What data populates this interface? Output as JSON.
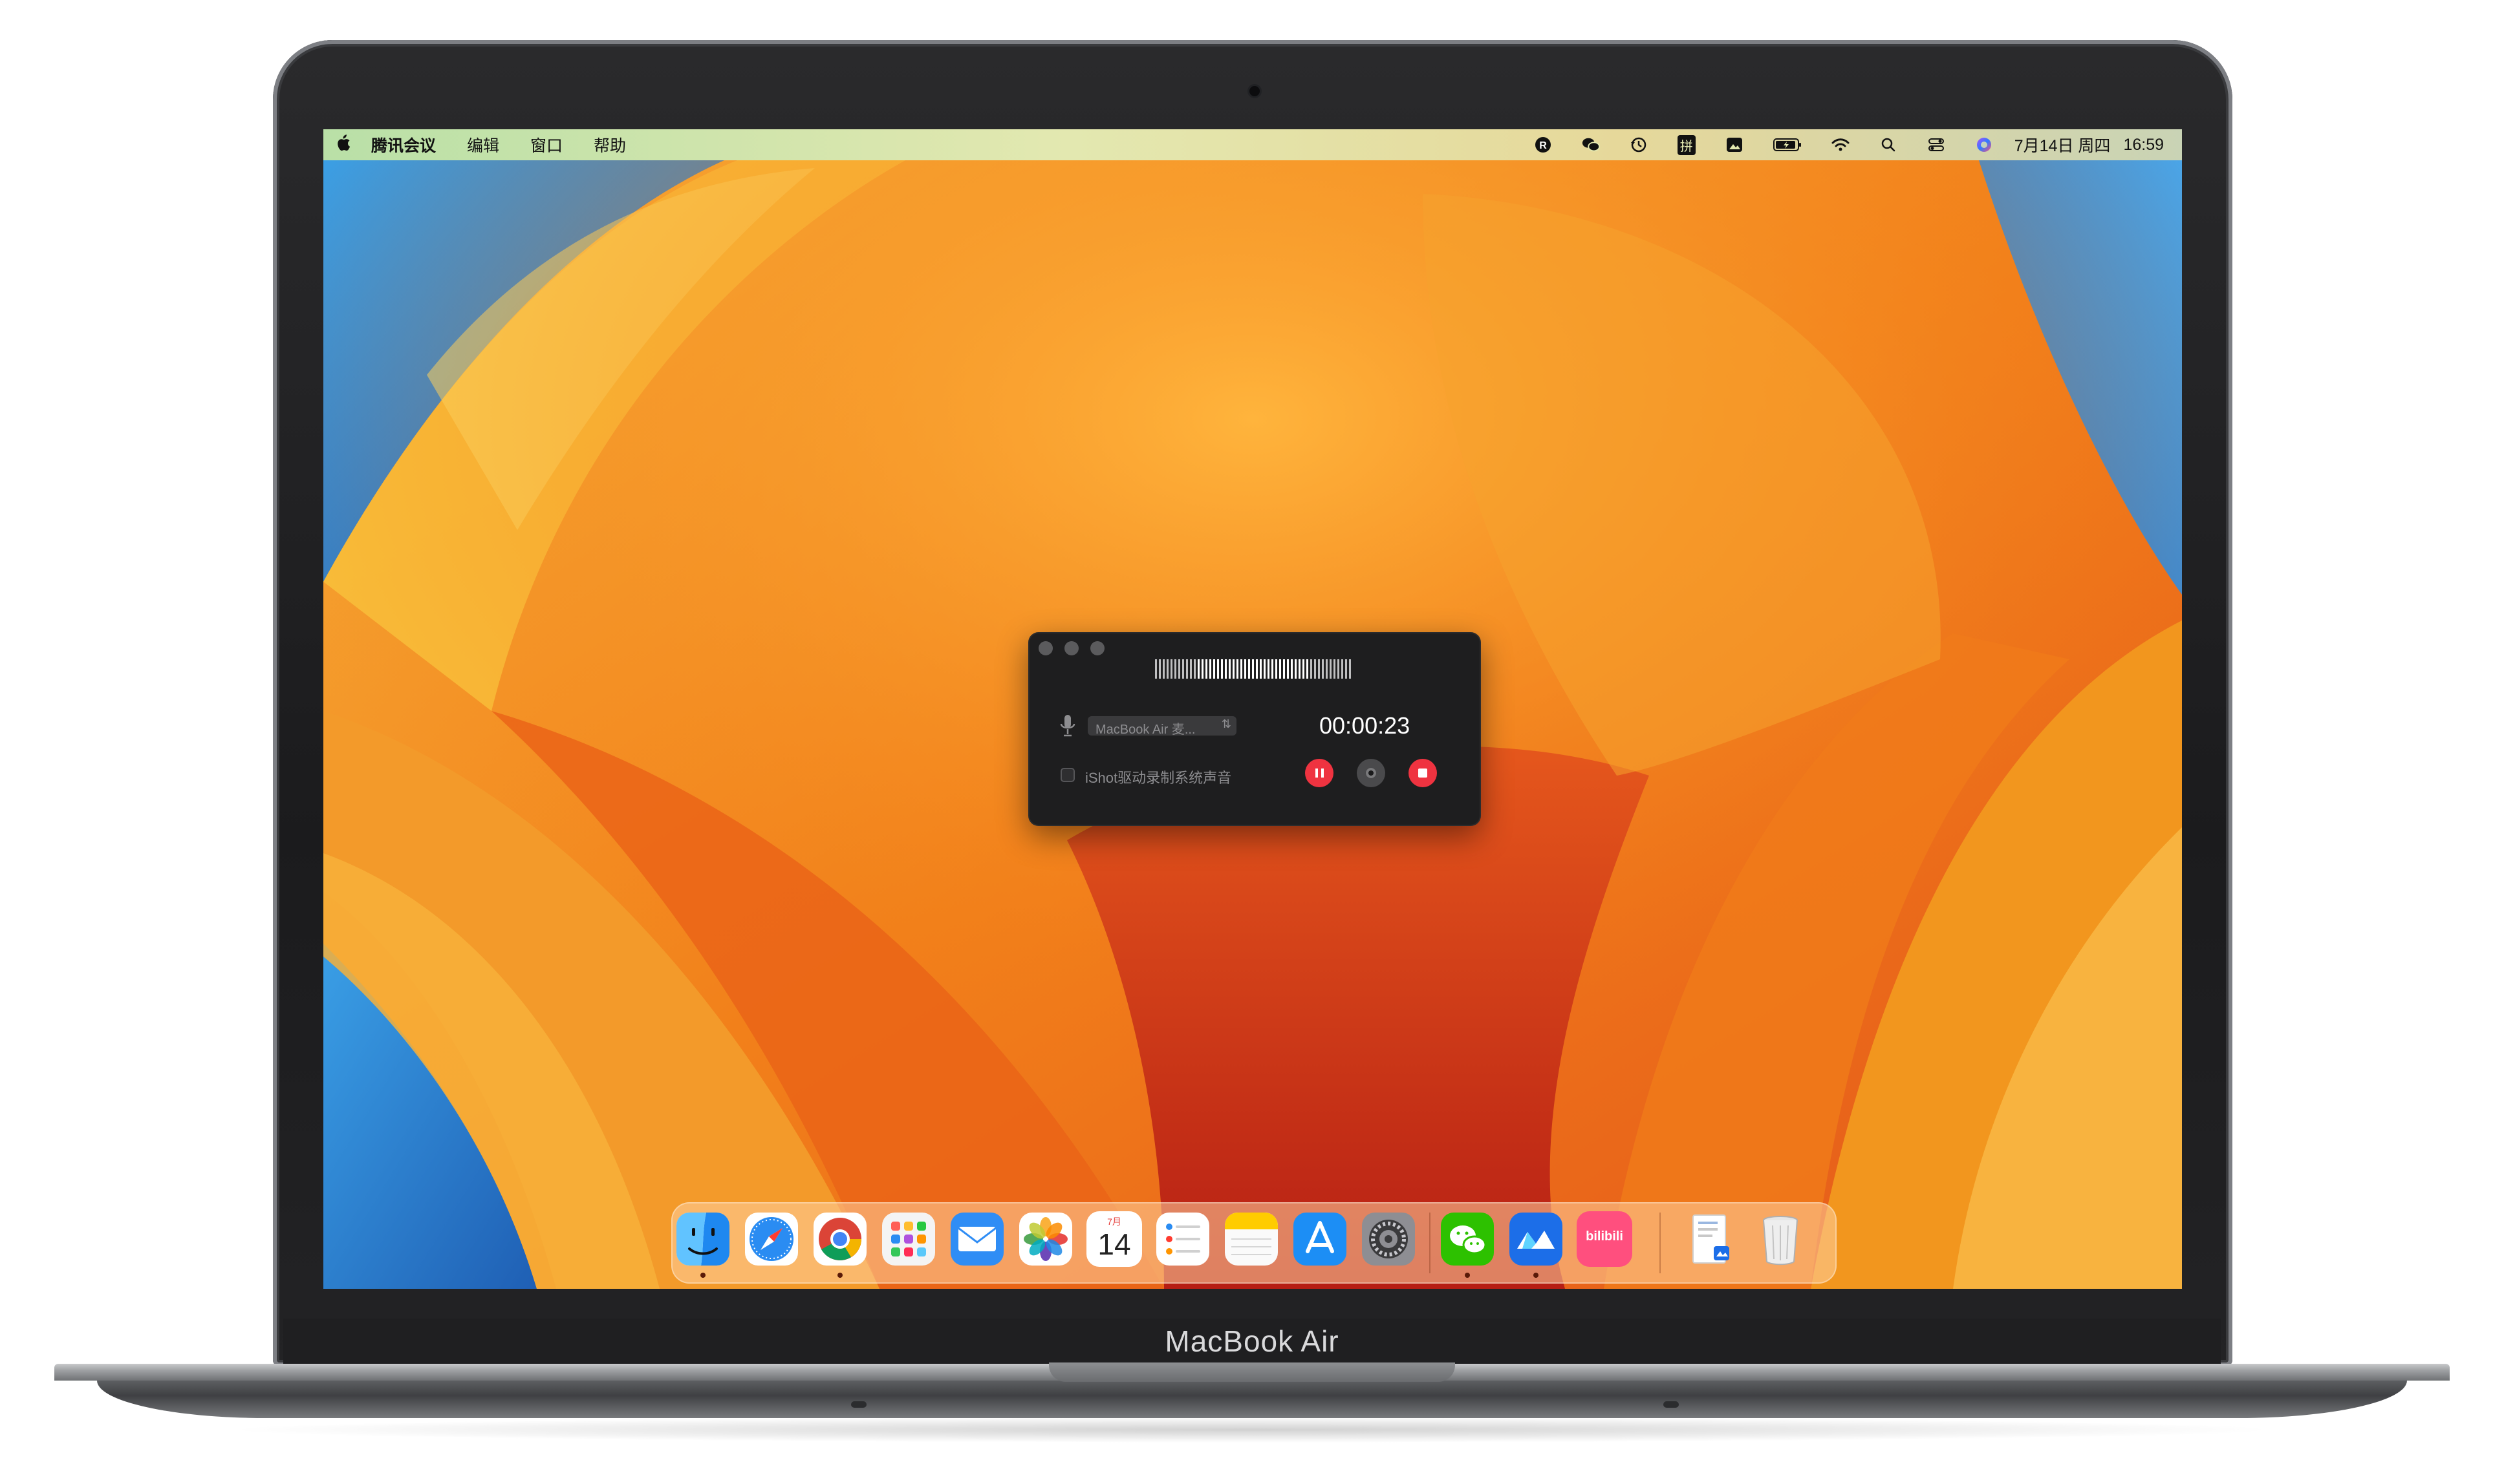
{
  "device": {
    "brand": "MacBook Air"
  },
  "menubar": {
    "apple_icon": "apple-icon",
    "app_name": "腾讯会议",
    "menus": [
      "编辑",
      "窗口",
      "帮助"
    ],
    "status_icons": [
      "r-app-icon",
      "wechat-icon",
      "time-machine-icon",
      "input-method-icon",
      "screenshot-icon",
      "battery-icon",
      "wifi-icon",
      "search-icon",
      "control-center-icon",
      "siri-icon"
    ],
    "input_method_label": "拼",
    "date": "7月14日 周四",
    "time": "16:59"
  },
  "recorder": {
    "device_select": "MacBook Air 麦...",
    "timer": "00:00:23",
    "system_audio_label": "iShot驱动录制系统声音",
    "system_audio_checked": false,
    "buttons": [
      "pause-icon",
      "camera-icon",
      "stop-icon"
    ]
  },
  "dock": {
    "apps": [
      "Finder",
      "Safari",
      "Chrome",
      "Launchpad",
      "Mail",
      "Photos",
      "Calendar",
      "Reminders",
      "Notes",
      "App Store",
      "System Settings",
      "WeChat",
      "Lark",
      "bilibili",
      "Downloads",
      "Trash"
    ],
    "calendar_month": "7月",
    "calendar_day": "14",
    "bilibili_label": "bilibili",
    "running": [
      "Finder",
      "Chrome",
      "WeChat",
      "Lark"
    ]
  },
  "colors": {
    "accent_red": "#ef3340",
    "recorder_bg": "#1e1e1f",
    "wallpaper_orange": "#f28a12"
  }
}
